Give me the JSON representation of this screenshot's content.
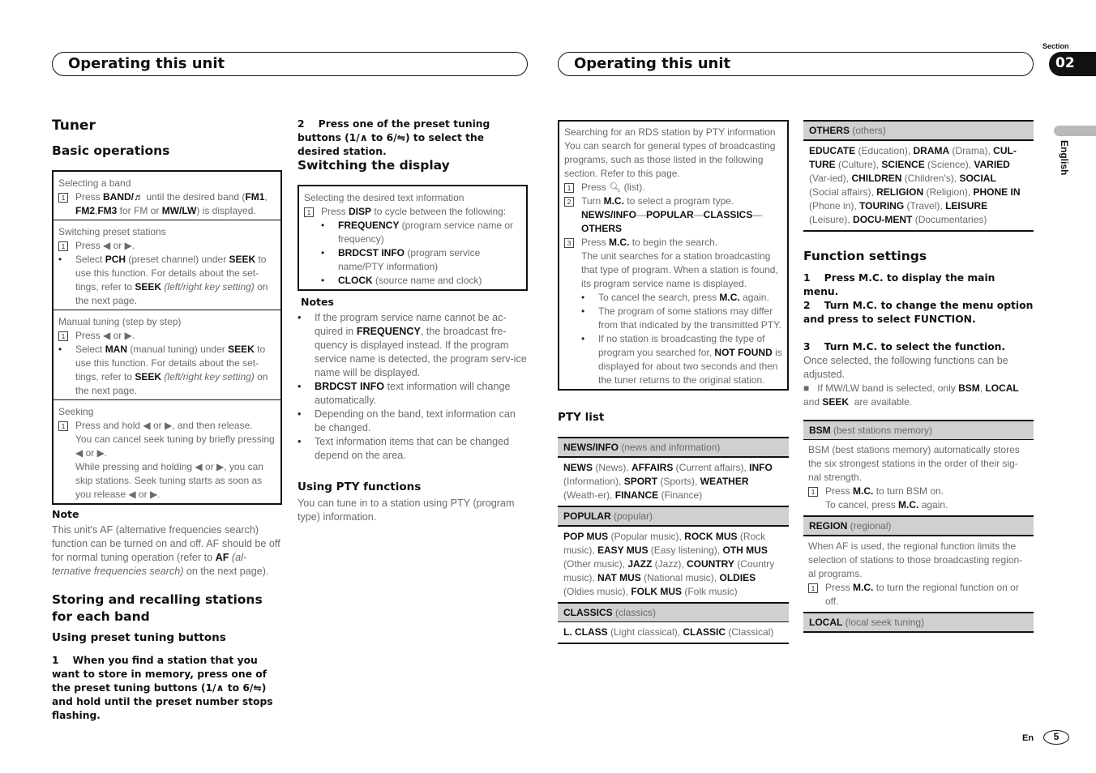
{
  "header": {
    "left_title": "Operating this unit",
    "right_title": "Operating this unit",
    "section_label": "Section",
    "section_number": "02",
    "language_tab": "English"
  },
  "footer": {
    "lang": "En",
    "page": "5"
  },
  "col1": {
    "title": "Tuner",
    "basic_heading": "Basic operations",
    "box": [
      {
        "title": "Selecting a band",
        "step1_html": "Press <b>BAND/&#9836;</b> until the desired band (<b>FM1</b>, <b>FM2</b>,<b>FM3</b> for FM or <b>MW/LW</b>) is displayed."
      },
      {
        "title": "Switching preset stations",
        "step1_html": "Press &#9664; or &#9654;.",
        "bullet_html": "Select <b>PCH</b> (preset channel) under <b>SEEK</b> to use this function. For details about the set-tings, refer to <b>SEEK</b> <i>(left/right key setting)</i> on the next page."
      },
      {
        "title": "Manual tuning (step by step)",
        "step1_html": "Press &#9664; or &#9654;.",
        "bullet_html": "Select <b>MAN</b> (manual tuning) under <b>SEEK</b> to use this function. For details about the set-tings, refer to <b>SEEK</b> <i>(left/right key setting)</i> on the next page."
      },
      {
        "title": "Seeking",
        "step1_html": "Press and hold &#9664; or &#9654;, and then release.",
        "extra1_html": "You can cancel seek tuning by briefly pressing &#9664; or &#9654;.",
        "extra2_html": "While pressing and holding &#9664; or &#9654;, you can skip stations. Seek tuning starts as soon as you release &#9664; or &#9654;."
      }
    ],
    "note_heading": "Note",
    "note_html": "This unit's AF (alternative frequencies search) function can be turned on and off. AF should be off for normal tuning operation (refer to <b>AF</b> <i>(al-ternative frequencies search)</i> on the next page).",
    "storing_heading": "Storing and recalling stations for each band",
    "preset_heading": "Using preset tuning buttons",
    "step1_html": "1&nbsp;&nbsp;&nbsp; When you find a station that you want to store in memory, press one of the preset tuning buttons (1/&#8743; to 6/&#8651;) and hold until the preset number stops flashing."
  },
  "col2": {
    "step2_html": "2&nbsp;&nbsp;&nbsp; Press one of the preset tuning buttons (1/&#8743; to 6/&#8651;) to select the desired station.",
    "display_heading": "Switching the display",
    "box": {
      "title": "Selecting the desired text information",
      "step1_html": "Press <b>DISP</b> to cycle between the following:",
      "bullets_html": [
        "<b>FREQUENCY</b> (program service name or frequency)",
        "<b>BRDCST INFO</b> (program service name/PTY information)",
        "<b>CLOCK</b> (source name and clock)"
      ]
    },
    "notes_heading": "Notes",
    "notes_html": [
      "If the program service name cannot be ac-quired in <b>FREQUENCY</b>, the broadcast fre-quency is displayed instead. If the program service name is detected, the program serv-ice name will be displayed.",
      "<b>BRDCST INFO</b> text information will change automatically.",
      "Depending on the band, text information can be changed.",
      "Text information items that can be changed depend on the area."
    ],
    "pty_heading": "Using PTY functions",
    "pty_text": "You can tune in to a station using PTY (program type) information."
  },
  "col3": {
    "box": {
      "title": "Searching for an RDS station by PTY information",
      "intro": "You can search for general types of broadcasting programs, such as those listed in the following section. Refer to this page.",
      "step1_html": "Press &#128269;&#xFE0E; (list).",
      "step2_html": "Turn <b>M.C.</b> to select a program type.",
      "step2_options_html": "<b>NEWS/INFO</b>&mdash;<b>POPULAR</b>&mdash;<b>CLASSICS</b>&mdash;<b>OTHERS</b>",
      "step3_html": "Press <b>M.C.</b> to begin the search.",
      "step3_extra": "The unit searches for a station broadcasting that type of program. When a station is found, its program service name is displayed.",
      "bullets_html": [
        "To cancel the search, press <b>M.C.</b> again.",
        "The program of some stations may differ from that indicated by the transmitted PTY.",
        "If no station is broadcasting the type of program you searched for, <b>NOT FOUND</b> is displayed for about two seconds and then the tuner returns to the original station."
      ]
    },
    "pty_list_heading": "PTY list",
    "pty_table": [
      {
        "head_html": "<b>NEWS/INFO</b> (news and information)",
        "body_html": "<b>NEWS</b> (News), <b>AFFAIRS</b> (Current affairs), <b>INFO</b> (Information), <b>SPORT</b> (Sports), <b>WEATHER</b> (Weath-er), <b>FINANCE</b> (Finance)"
      },
      {
        "head_html": "<b>POPULAR</b> (popular)",
        "body_html": "<b>POP MUS</b> (Popular music), <b>ROCK MUS</b> (Rock music), <b>EASY MUS</b> (Easy listening), <b>OTH MUS</b> (Other music), <b>JAZZ</b> (Jazz), <b>COUNTRY</b> (Country music), <b>NAT MUS</b> (National music), <b>OLDIES</b> (Oldies music), <b>FOLK MUS</b> (Folk music)"
      },
      {
        "head_html": "<b>CLASSICS</b> (classics)",
        "body_html": "<b>L. CLASS</b> (Light classical), <b>CLASSIC</b> (Classical)"
      }
    ]
  },
  "col4": {
    "others_table": {
      "head_html": "<b>OTHERS</b> (others)",
      "body_html": "<b>EDUCATE</b> (Education), <b>DRAMA</b> (Drama), <b>CUL-TURE</b> (Culture), <b>SCIENCE</b> (Science), <b>VARIED</b> (Var-ied), <b>CHILDREN</b> (Children's), <b>SOCIAL</b> (Social affairs), <b>RELIGION</b> (Religion), <b>PHONE IN</b> (Phone in), <b>TOURING</b> (Travel), <b>LEISURE</b> (Leisure), <b>DOCU-MENT</b> (Documentaries)"
    },
    "func_heading": "Function settings",
    "step1": "1    Press M.C. to display the main menu.",
    "step2": "2    Turn M.C. to change the menu option and press to select FUNCTION.",
    "step3": "3    Turn M.C. to select the function.",
    "step3_text": "Once selected, the following functions can be adjusted.",
    "mwlw_note_html": "&#9632;&nbsp;&nbsp; If MW/LW band is selected, only <b>BSM</b>, <b>LOCAL</b> and <b>SEEK</b>&nbsp; are available.",
    "functions": [
      {
        "head_html": "<b>BSM</b> (best stations memory)",
        "desc": "BSM (best stations memory) automatically stores the six strongest stations in the order of their sig-nal strength.",
        "step1_html": "Press <b>M.C.</b> to turn BSM on.",
        "extra_html": "To cancel, press <b>M.C.</b> again."
      },
      {
        "head_html": "<b>REGION</b> (regional)",
        "desc": "When AF is used, the regional function limits the selection of stations to those broadcasting region-al programs.",
        "step1_html": "Press <b>M.C.</b> to turn the regional function on or off."
      },
      {
        "head_html": "<b>LOCAL</b> (local seek tuning)"
      }
    ]
  }
}
